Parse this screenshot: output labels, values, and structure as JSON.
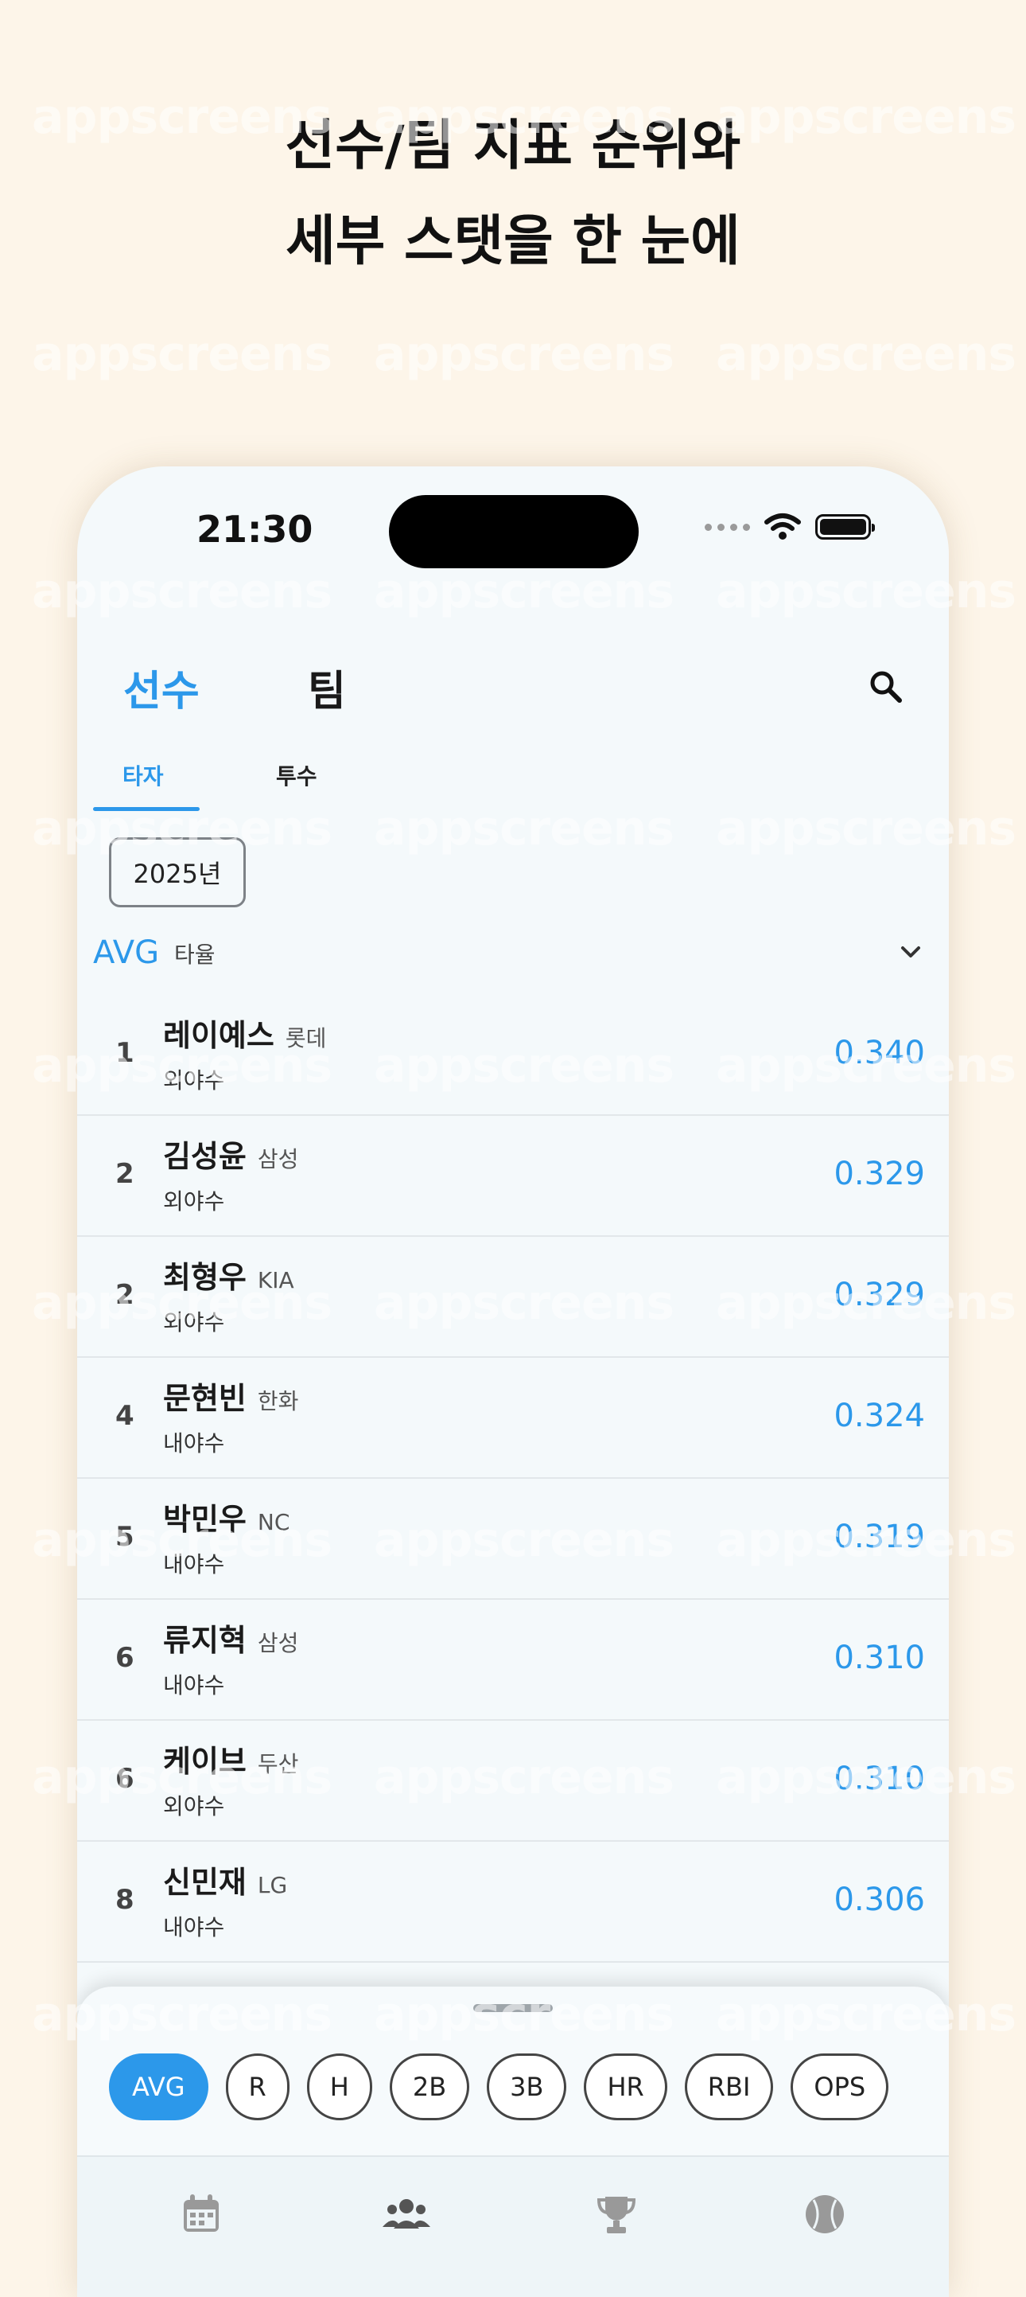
{
  "headline": {
    "line1": "선수/팀 지표 순위와",
    "line2": "세부 스탯을 한 눈에"
  },
  "watermark": "appscreens",
  "status_bar": {
    "time": "21:30"
  },
  "top_tabs": {
    "players": "선수",
    "teams": "팀",
    "active": "players",
    "active_color": "#2c98ea",
    "inactive_color": "#1a1a1a"
  },
  "sub_tabs": {
    "batter": "타자",
    "pitcher": "투수",
    "active": "batter"
  },
  "season": {
    "label": "2025년"
  },
  "metric": {
    "code": "AVG",
    "name": "타율"
  },
  "players": [
    {
      "rank": "1",
      "name": "레이예스",
      "team": "롯데",
      "position": "외야수",
      "value": "0.340"
    },
    {
      "rank": "2",
      "name": "김성윤",
      "team": "삼성",
      "position": "외야수",
      "value": "0.329"
    },
    {
      "rank": "2",
      "name": "최형우",
      "team": "KIA",
      "position": "외야수",
      "value": "0.329"
    },
    {
      "rank": "4",
      "name": "문현빈",
      "team": "한화",
      "position": "내야수",
      "value": "0.324"
    },
    {
      "rank": "5",
      "name": "박민우",
      "team": "NC",
      "position": "내야수",
      "value": "0.319"
    },
    {
      "rank": "6",
      "name": "류지혁",
      "team": "삼성",
      "position": "내야수",
      "value": "0.310"
    },
    {
      "rank": "6",
      "name": "케이브",
      "team": "두산",
      "position": "외야수",
      "value": "0.310"
    },
    {
      "rank": "8",
      "name": "신민재",
      "team": "LG",
      "position": "내야수",
      "value": "0.306"
    }
  ],
  "metric_chips": {
    "items": [
      "AVG",
      "R",
      "H",
      "2B",
      "3B",
      "HR",
      "RBI",
      "OPS"
    ],
    "selected": "AVG"
  },
  "bottom_nav": {
    "icons": [
      "calendar-icon",
      "team-icon",
      "trophy-icon",
      "baseball-icon"
    ]
  },
  "colors": {
    "accent": "#2c98ea",
    "background": "#fdf5e9",
    "screen": "#f4f9fb"
  }
}
